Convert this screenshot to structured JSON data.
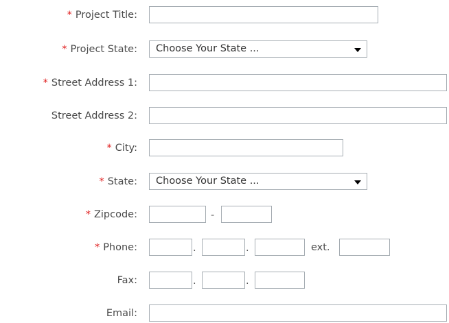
{
  "form": {
    "required_marker": "*",
    "project_title": {
      "label": "Project Title:",
      "value": ""
    },
    "project_state": {
      "label": "Project State:",
      "selected": "Choose Your State ..."
    },
    "street1": {
      "label": "Street Address 1:",
      "value": ""
    },
    "street2": {
      "label": "Street Address 2:",
      "value": ""
    },
    "city": {
      "label": "City:",
      "value": ""
    },
    "state": {
      "label": "State:",
      "selected": "Choose Your State ..."
    },
    "zipcode": {
      "label": "Zipcode:",
      "separator": "-",
      "part1": "",
      "part2": ""
    },
    "phone": {
      "label": "Phone:",
      "dot": ".",
      "ext_label": "ext.",
      "area": "",
      "prefix": "",
      "line": "",
      "ext": ""
    },
    "fax": {
      "label": "Fax:",
      "dot": ".",
      "area": "",
      "prefix": "",
      "line": ""
    },
    "email": {
      "label": "Email:",
      "value": ""
    }
  },
  "colors": {
    "required": "#e02020",
    "label_text": "#4a4a4a",
    "border": "#a5acb2"
  }
}
